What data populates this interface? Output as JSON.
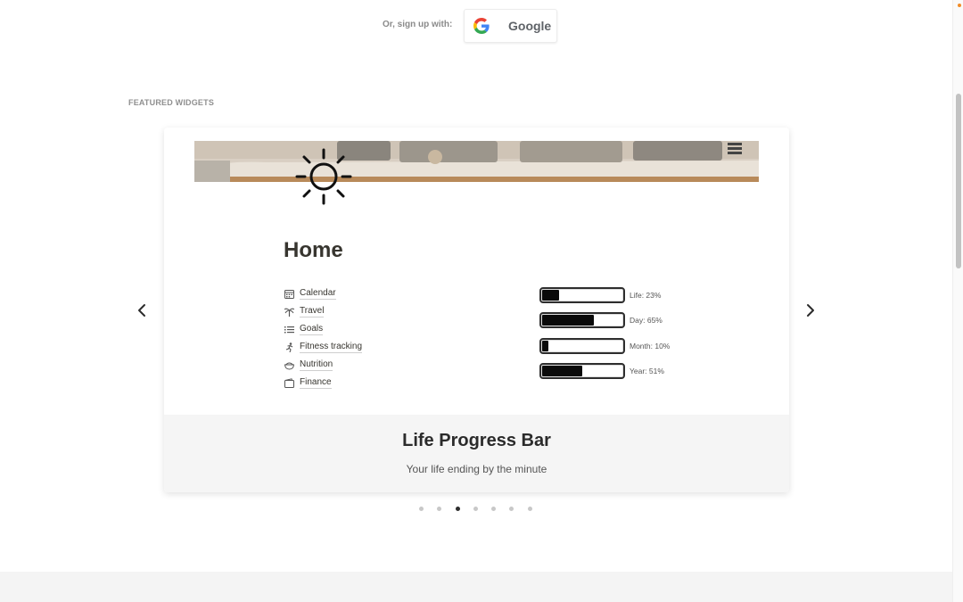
{
  "signup": {
    "label": "Or, sign up with:",
    "provider_label": "Google",
    "icon": "google-logo-icon"
  },
  "featured": {
    "section_label": "FEATURED WIDGETS",
    "card": {
      "page_title": "Home",
      "nav_items": [
        {
          "label": "Calendar",
          "icon": "calendar-icon"
        },
        {
          "label": "Travel",
          "icon": "palm-tree-icon"
        },
        {
          "label": "Goals",
          "icon": "list-icon"
        },
        {
          "label": "Fitness tracking",
          "icon": "runner-icon"
        },
        {
          "label": "Nutrition",
          "icon": "food-bowl-icon"
        },
        {
          "label": "Finance",
          "icon": "wallet-icon"
        }
      ],
      "progress": [
        {
          "label": "Life: 23%",
          "fraction": 0.23
        },
        {
          "label": "Day: 65%",
          "fraction": 0.65
        },
        {
          "label": "Month: 10%",
          "fraction": 0.1
        },
        {
          "label": "Year: 51%",
          "fraction": 0.51
        }
      ],
      "title": "Life Progress Bar",
      "subtitle": "Your life ending by the minute"
    },
    "carousel": {
      "slide_count": 7,
      "active_index": 2
    }
  },
  "colors": {
    "accent_dot": "#f28c28",
    "bar_fill": "#0a0a0a",
    "footer_bg": "#f5f5f5"
  }
}
